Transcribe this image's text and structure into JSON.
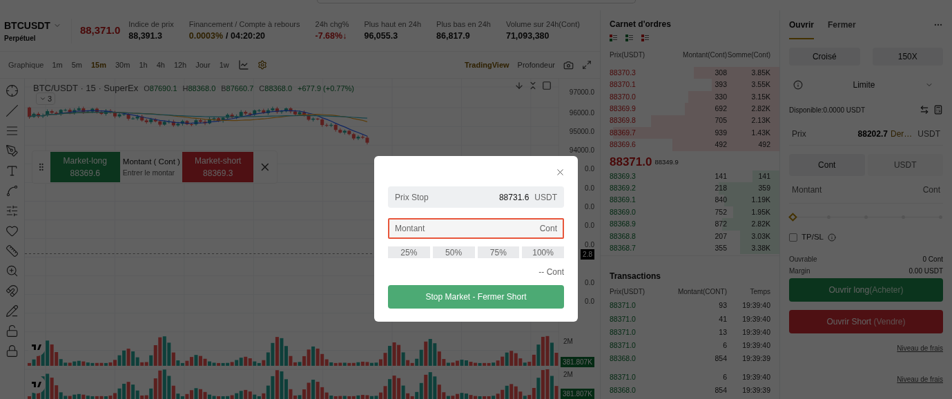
{
  "ticker": {
    "symbol": "BTCUSDT",
    "contract": "Perpétuel",
    "last_price": "88,371.0"
  },
  "stats": [
    {
      "label": "Indice de prix",
      "values": [
        {
          "text": "88,391.3",
          "kind": "neutral"
        }
      ]
    },
    {
      "label": "Financement / Compte à rebours",
      "values": [
        {
          "text": "0.0003%",
          "kind": "highlight"
        },
        {
          "text": "/ 04:20:20",
          "kind": "neutral"
        }
      ]
    },
    {
      "label": "24h chg%",
      "values": [
        {
          "text": "-7.68%↓",
          "kind": "down"
        }
      ]
    },
    {
      "label": "Plus haut en 24h",
      "values": [
        {
          "text": "96,055.3",
          "kind": "neutral"
        }
      ]
    },
    {
      "label": "Plus bas en 24h",
      "values": [
        {
          "text": "86,817.9",
          "kind": "neutral"
        }
      ]
    },
    {
      "label": "Volume sur 24h(Cont)",
      "values": [
        {
          "text": "71,093,380",
          "kind": "neutral"
        }
      ]
    }
  ],
  "chart_toolbar": {
    "mode_label": "Graphique",
    "intervals": [
      {
        "label": "1m",
        "selected": false
      },
      {
        "label": "5m",
        "selected": false
      },
      {
        "label": "15m",
        "selected": true
      },
      {
        "label": "30m",
        "selected": false
      },
      {
        "label": "1h",
        "selected": false
      },
      {
        "label": "4h",
        "selected": false
      },
      {
        "label": "12h",
        "selected": false
      },
      {
        "label": "Jour",
        "selected": false
      },
      {
        "label": "1w",
        "selected": false
      }
    ],
    "views": [
      {
        "label": "TradingView",
        "selected": true
      },
      {
        "label": "Profondeur",
        "selected": false
      }
    ]
  },
  "chart": {
    "legend_title": "BTC/USDT · 15 · SuperEx",
    "ohlc": [
      {
        "label": "O",
        "value": "87690.1"
      },
      {
        "label": "H",
        "value": "88368.0"
      },
      {
        "label": "B",
        "value": "87660.7"
      },
      {
        "label": "C",
        "value": "88368.0"
      }
    ],
    "change": "+677.9 (+0.77%)",
    "indicator_count": "3",
    "price_axis": [
      "97000.0",
      "96000.0",
      "95000.0",
      "94000.0",
      "0.0",
      "0.0",
      "0.0",
      "0.0",
      "0.0",
      "0.0",
      "0.0"
    ],
    "price_tag": "2.8",
    "volume_axis": [
      "2M",
      "2M"
    ],
    "volume_tags": [
      "381.807K",
      "381.807K"
    ]
  },
  "quick_trade": {
    "long": {
      "label": "Market-long",
      "price": "88369.6"
    },
    "amount_label": "Montant ( Cont )",
    "amount_placeholder": "Entrer le montar",
    "short": {
      "label": "Market-short",
      "price": "88369.3"
    }
  },
  "order_book": {
    "title": "Carnet d'ordres",
    "columns": [
      "Prix(USDT)",
      "Montant(Cont)",
      "Somme(Cont)"
    ],
    "asks": [
      {
        "price": "88370.3",
        "amount": "308",
        "total": "3.85K"
      },
      {
        "price": "88370.1",
        "amount": "393",
        "total": "3.55K"
      },
      {
        "price": "88370.0",
        "amount": "330",
        "total": "3.15K"
      },
      {
        "price": "88369.9",
        "amount": "692",
        "total": "2.82K"
      },
      {
        "price": "88369.8",
        "amount": "705",
        "total": "2.13K"
      },
      {
        "price": "88369.7",
        "amount": "939",
        "total": "1.43K"
      },
      {
        "price": "88369.6",
        "amount": "492",
        "total": "492"
      }
    ],
    "last_price": "88371.0",
    "mark_price": "88349.9",
    "bids": [
      {
        "price": "88369.3",
        "amount": "141",
        "total": "141"
      },
      {
        "price": "88369.2",
        "amount": "218",
        "total": "359"
      },
      {
        "price": "88369.1",
        "amount": "840",
        "total": "1.19K"
      },
      {
        "price": "88369.0",
        "amount": "752",
        "total": "1.95K"
      },
      {
        "price": "88368.9",
        "amount": "872",
        "total": "2.82K"
      },
      {
        "price": "88368.8",
        "amount": "207",
        "total": "3.03K"
      },
      {
        "price": "88368.7",
        "amount": "355",
        "total": "3.38K"
      }
    ]
  },
  "trades": {
    "title": "Transactions",
    "columns": [
      "Prix(USDT)",
      "Montant(CONT)",
      "Temps"
    ],
    "rows": [
      {
        "price": "88371.0",
        "amount": "93",
        "time": "19:39:40"
      },
      {
        "price": "88371.0",
        "amount": "41",
        "time": "19:39:40"
      },
      {
        "price": "88371.0",
        "amount": "13",
        "time": "19:39:40"
      },
      {
        "price": "88371.0",
        "amount": "6",
        "time": "19:39:40"
      },
      {
        "price": "88368.0",
        "amount": "854",
        "time": "19:39:39"
      },
      {
        "price": "88371.0",
        "amount": "6",
        "time": "19:39:40"
      },
      {
        "price": "88368.0",
        "amount": "854",
        "time": "19:39:39"
      }
    ]
  },
  "order_form": {
    "tabs": [
      {
        "label": "Ouvrir",
        "selected": true
      },
      {
        "label": "Fermer",
        "selected": false
      }
    ],
    "margin_mode": "Croisé",
    "leverage": "150X",
    "order_type": "Limite",
    "available": "Disponible:0.0000 USDT",
    "price": {
      "label": "Prix",
      "value": "88202.7",
      "tag": "Der…",
      "unit": "USDT"
    },
    "units": [
      {
        "label": "Cont",
        "selected": true
      },
      {
        "label": "USDT",
        "selected": false
      }
    ],
    "amount": {
      "placeholder": "Montant",
      "unit": "Cont"
    },
    "slider": {
      "level": 0
    },
    "tpsl": {
      "label": "TP/SL",
      "checked": false
    },
    "info": [
      {
        "label": "Ouvrable",
        "value": "0 Cont"
      },
      {
        "label": "Margin",
        "value": "0.00 USDT"
      }
    ],
    "buy_button": {
      "label": "Ouvrir long",
      "sub": "(Acheter)"
    },
    "sell_button": {
      "label": "Ouvrir Short",
      "sub": "(Vendre)"
    },
    "fee_links": [
      "Niveau de frais",
      "Niveau de frais"
    ]
  },
  "dialog": {
    "stop_price": {
      "label": "Prix Stop",
      "value": "88731.6",
      "unit": "USDT"
    },
    "amount": {
      "placeholder": "Montant",
      "unit": "Cont",
      "highlighted": true
    },
    "percentages": [
      "25%",
      "50%",
      "75%",
      "100%"
    ],
    "estimate": "-- Cont",
    "submit": "Stop Market - Fermer Short"
  }
}
